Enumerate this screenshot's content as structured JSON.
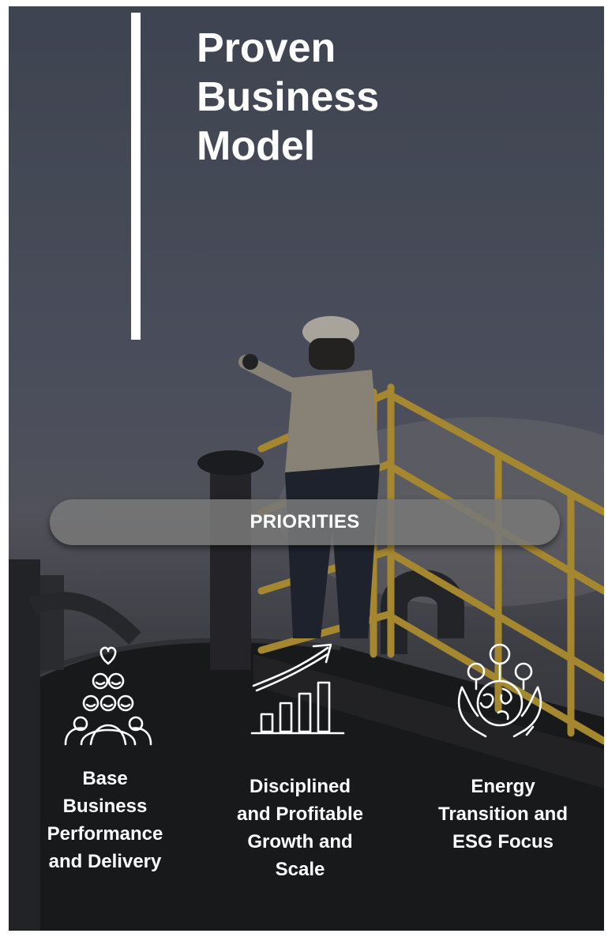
{
  "title": {
    "line1": "Proven",
    "line2": "Business",
    "line3": "Model"
  },
  "priorities": {
    "label": "PRIORITIES"
  },
  "pillars": [
    {
      "icon": "people-heart-icon",
      "label": "Base\nBusiness\nPerformance\nand Delivery"
    },
    {
      "icon": "growth-chart-icon",
      "label": "Disciplined\nand Profitable\nGrowth and\nScale"
    },
    {
      "icon": "earth-hands-icon",
      "label": "Energy\nTransition and\nESG Focus"
    }
  ],
  "background": {
    "photo": "oilfield-worker-on-platform-image"
  }
}
